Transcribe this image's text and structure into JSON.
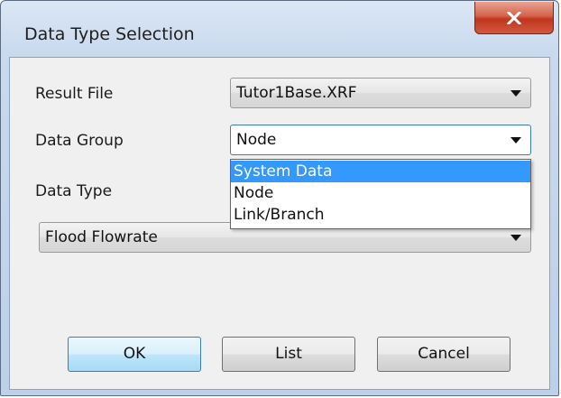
{
  "window": {
    "title": "Data Type Selection",
    "close_glyph": "X"
  },
  "form": {
    "result_file_label": "Result File",
    "result_file_value": "Tutor1Base.XRF",
    "data_group_label": "Data Group",
    "data_group_value": "Node",
    "data_type_label": "Data Type",
    "data_type_value": "Flood Flowrate"
  },
  "data_group_dropdown": {
    "options": [
      "System Data",
      "Node",
      "Link/Branch"
    ],
    "highlighted_index": 0
  },
  "buttons": {
    "ok": "OK",
    "list": "List",
    "cancel": "Cancel"
  },
  "colors": {
    "highlight": "#3399ff",
    "close_button": "#c2351b",
    "focus_border": "#3c7fb1"
  }
}
